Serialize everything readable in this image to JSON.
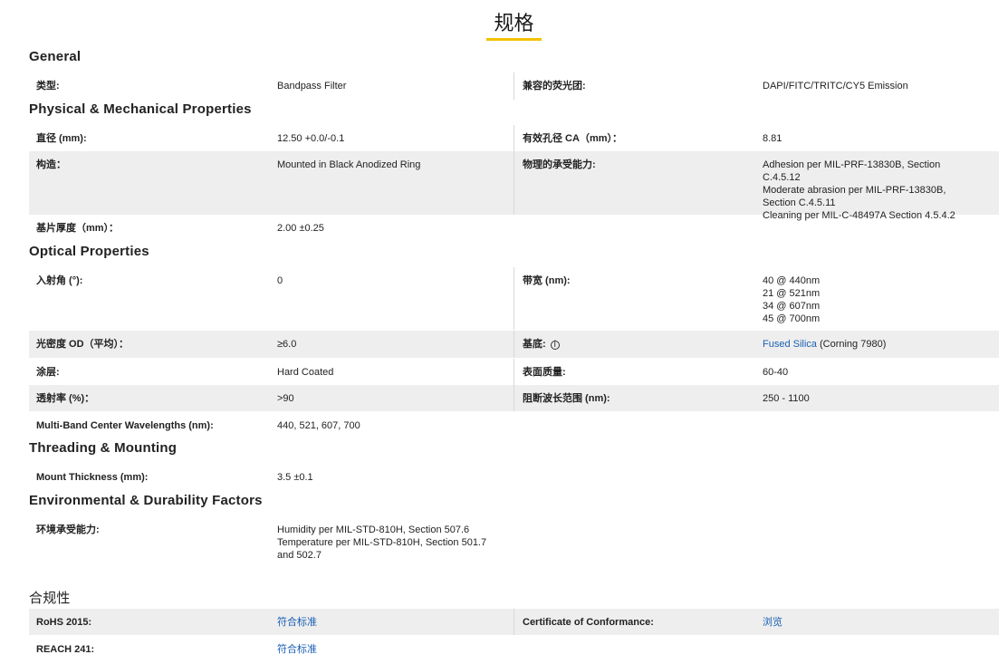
{
  "page": {
    "title": "规格"
  },
  "general": {
    "heading": "General",
    "type_label": "类型:",
    "type_value": "Bandpass Filter",
    "compat_label": "兼容的荧光团:",
    "compat_value": "DAPI/FITC/TRITC/CY5 Emission"
  },
  "physical": {
    "heading": "Physical & Mechanical Properties",
    "diameter_label": "直径 (mm):",
    "diameter_value": "12.50 +0.0/-0.1",
    "ca_label": "有效孔径 CA（mm）：",
    "ca_value": "8.81",
    "construction_label": "构造：",
    "construction_value": "Mounted in Black Anodized Ring",
    "durability_label": "物理的承受能力:",
    "durability_value": "Adhesion per MIL-PRF-13830B, Section C.4.5.12\nModerate abrasion per MIL-PRF-13830B, Section C.4.5.11\nCleaning per MIL-C-48497A Section 4.5.4.2",
    "thickness_label": "基片厚度（mm）：",
    "thickness_value": "2.00 ±0.25"
  },
  "optical": {
    "heading": "Optical Properties",
    "aoi_label": "入射角 (°):",
    "aoi_value": "0",
    "bandwidth_label": "带宽 (nm):",
    "bandwidth_value": "40 @ 440nm\n21 @ 521nm\n34 @ 607nm\n45 @ 700nm",
    "od_label": "光密度 OD（平均）：",
    "od_value": "≥6.0",
    "substrate_label": "基底:",
    "substrate_info": "i",
    "substrate_link": "Fused Silica",
    "substrate_suffix": " (Corning 7980)",
    "coating_label": "涂层:",
    "coating_value": "Hard Coated",
    "surface_label": "表面质量:",
    "surface_value": "60-40",
    "transmission_label": "透射率 (%)：",
    "transmission_value": ">90",
    "blocking_label": "阻断波长范围 (nm):",
    "blocking_value": "250 - 1100",
    "multiband_label": "Multi-Band Center Wavelengths (nm):",
    "multiband_value": "440, 521, 607, 700"
  },
  "threading": {
    "heading": "Threading & Mounting",
    "mount_label": "Mount Thickness (mm):",
    "mount_value": "3.5 ±0.1"
  },
  "environmental": {
    "heading": "Environmental & Durability Factors",
    "env_label": "环境承受能力:",
    "env_value": "Humidity per MIL-STD-810H, Section 507.6\nTemperature per MIL-STD-810H, Section 501.7 and 502.7"
  },
  "compliance": {
    "heading": "合规性",
    "rohs_label": "RoHS 2015:",
    "rohs_value": "符合标准",
    "coc_label": "Certificate of Conformance:",
    "coc_value": "浏览",
    "reach_label": "REACH 241:",
    "reach_value": "符合标准"
  },
  "colors": {
    "accent": "#f2c200",
    "link": "#1a5fb4",
    "row_shade": "#eeeeee"
  }
}
